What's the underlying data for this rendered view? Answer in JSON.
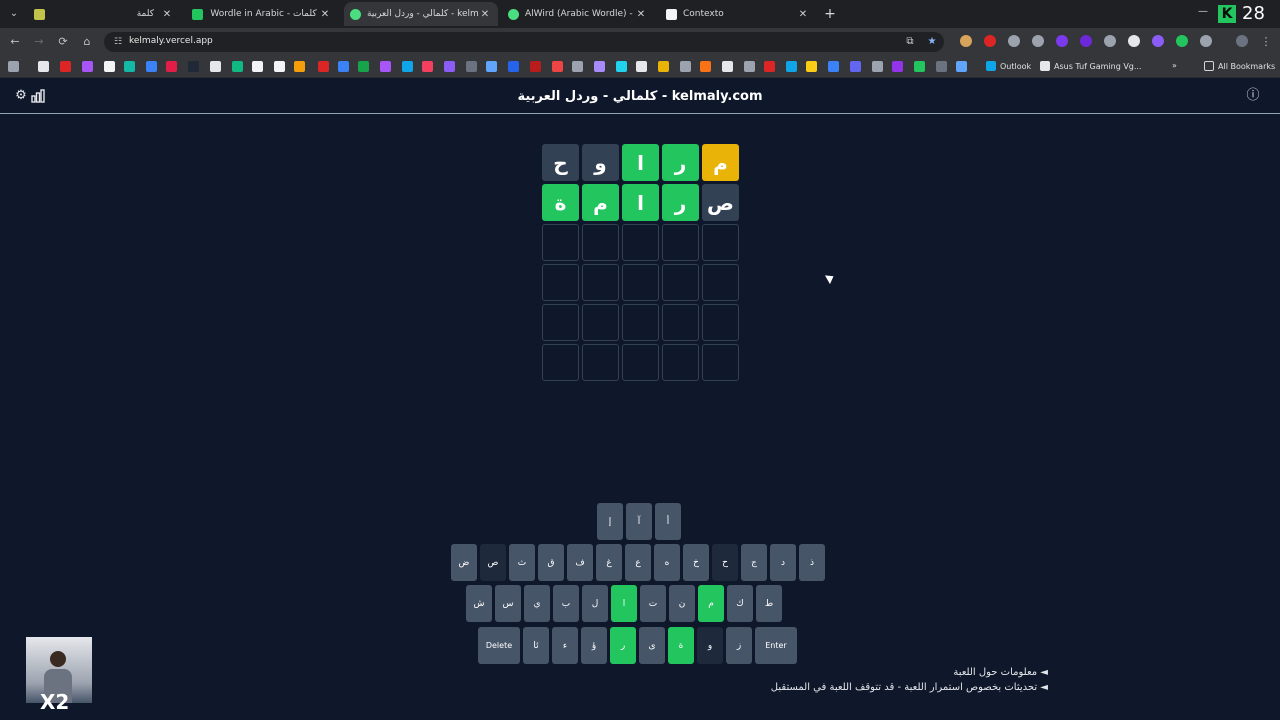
{
  "browser": {
    "tabs": [
      {
        "title": "كلمة",
        "color": "#c2c34a"
      },
      {
        "title": "Wordle in Arabic - كلمات",
        "color": "#22c55e"
      },
      {
        "title": "كلمالي - وردل العربية - kelmaly.com",
        "color": "#4ade80"
      },
      {
        "title": "AlWird (Arabic Wordle) - الورد",
        "color": "#4ade80"
      },
      {
        "title": "Contexto",
        "color": "#f3f4f6"
      }
    ],
    "url": "kelmaly.vercel.app",
    "counter": "28",
    "bookmarks": {
      "outlook": "Outlook",
      "asus": "Asus Tuf Gaming Vg...",
      "all": "All Bookmarks"
    }
  },
  "app": {
    "title": "كلمالي - وردل العربية - kelmaly.com",
    "board": [
      [
        {
          "l": "م",
          "s": "present"
        },
        {
          "l": "ر",
          "s": "correct"
        },
        {
          "l": "ا",
          "s": "correct"
        },
        {
          "l": "و",
          "s": "absent"
        },
        {
          "l": "ح",
          "s": "absent"
        }
      ],
      [
        {
          "l": "ص",
          "s": "absent"
        },
        {
          "l": "ر",
          "s": "correct"
        },
        {
          "l": "ا",
          "s": "correct"
        },
        {
          "l": "م",
          "s": "correct"
        },
        {
          "l": "ة",
          "s": "correct"
        }
      ],
      [
        {
          "l": "",
          "s": "empty"
        },
        {
          "l": "",
          "s": "empty"
        },
        {
          "l": "",
          "s": "empty"
        },
        {
          "l": "",
          "s": "empty"
        },
        {
          "l": "",
          "s": "empty"
        }
      ],
      [
        {
          "l": "",
          "s": "empty"
        },
        {
          "l": "",
          "s": "empty"
        },
        {
          "l": "",
          "s": "empty"
        },
        {
          "l": "",
          "s": "empty"
        },
        {
          "l": "",
          "s": "empty"
        }
      ],
      [
        {
          "l": "",
          "s": "empty"
        },
        {
          "l": "",
          "s": "empty"
        },
        {
          "l": "",
          "s": "empty"
        },
        {
          "l": "",
          "s": "empty"
        },
        {
          "l": "",
          "s": "empty"
        }
      ],
      [
        {
          "l": "",
          "s": "empty"
        },
        {
          "l": "",
          "s": "empty"
        },
        {
          "l": "",
          "s": "empty"
        },
        {
          "l": "",
          "s": "empty"
        },
        {
          "l": "",
          "s": "empty"
        }
      ]
    ],
    "keyboard": {
      "row0": [
        {
          "l": "أ",
          "s": ""
        },
        {
          "l": "آ",
          "s": ""
        },
        {
          "l": "إ",
          "s": ""
        }
      ],
      "row1": [
        {
          "l": "ذ",
          "s": ""
        },
        {
          "l": "د",
          "s": ""
        },
        {
          "l": "ج",
          "s": ""
        },
        {
          "l": "ح",
          "s": "dark"
        },
        {
          "l": "خ",
          "s": ""
        },
        {
          "l": "ه",
          "s": ""
        },
        {
          "l": "ع",
          "s": ""
        },
        {
          "l": "غ",
          "s": ""
        },
        {
          "l": "ف",
          "s": ""
        },
        {
          "l": "ق",
          "s": ""
        },
        {
          "l": "ث",
          "s": ""
        },
        {
          "l": "ص",
          "s": "dark"
        },
        {
          "l": "ض",
          "s": ""
        }
      ],
      "row2": [
        {
          "l": "ط",
          "s": ""
        },
        {
          "l": "ك",
          "s": ""
        },
        {
          "l": "م",
          "s": "correct"
        },
        {
          "l": "ن",
          "s": ""
        },
        {
          "l": "ت",
          "s": ""
        },
        {
          "l": "ا",
          "s": "correct"
        },
        {
          "l": "ل",
          "s": ""
        },
        {
          "l": "ب",
          "s": ""
        },
        {
          "l": "ي",
          "s": ""
        },
        {
          "l": "س",
          "s": ""
        },
        {
          "l": "ش",
          "s": ""
        }
      ],
      "row3": [
        {
          "l": "Enter",
          "s": "wide"
        },
        {
          "l": "ز",
          "s": ""
        },
        {
          "l": "و",
          "s": "dark"
        },
        {
          "l": "ة",
          "s": "correct"
        },
        {
          "l": "ى",
          "s": ""
        },
        {
          "l": "ر",
          "s": "correct"
        },
        {
          "l": "ؤ",
          "s": ""
        },
        {
          "l": "ء",
          "s": ""
        },
        {
          "l": "ئا",
          "s": ""
        },
        {
          "l": "Delete",
          "s": "wide"
        }
      ]
    },
    "links": {
      "about": "◄ معلومات حول اللعبة",
      "updates": "◄ تحديثات بخصوص استمرار اللعبة - قد تتوقف اللعبة في المستقبل"
    },
    "overlay": {
      "badge": "X2"
    }
  }
}
